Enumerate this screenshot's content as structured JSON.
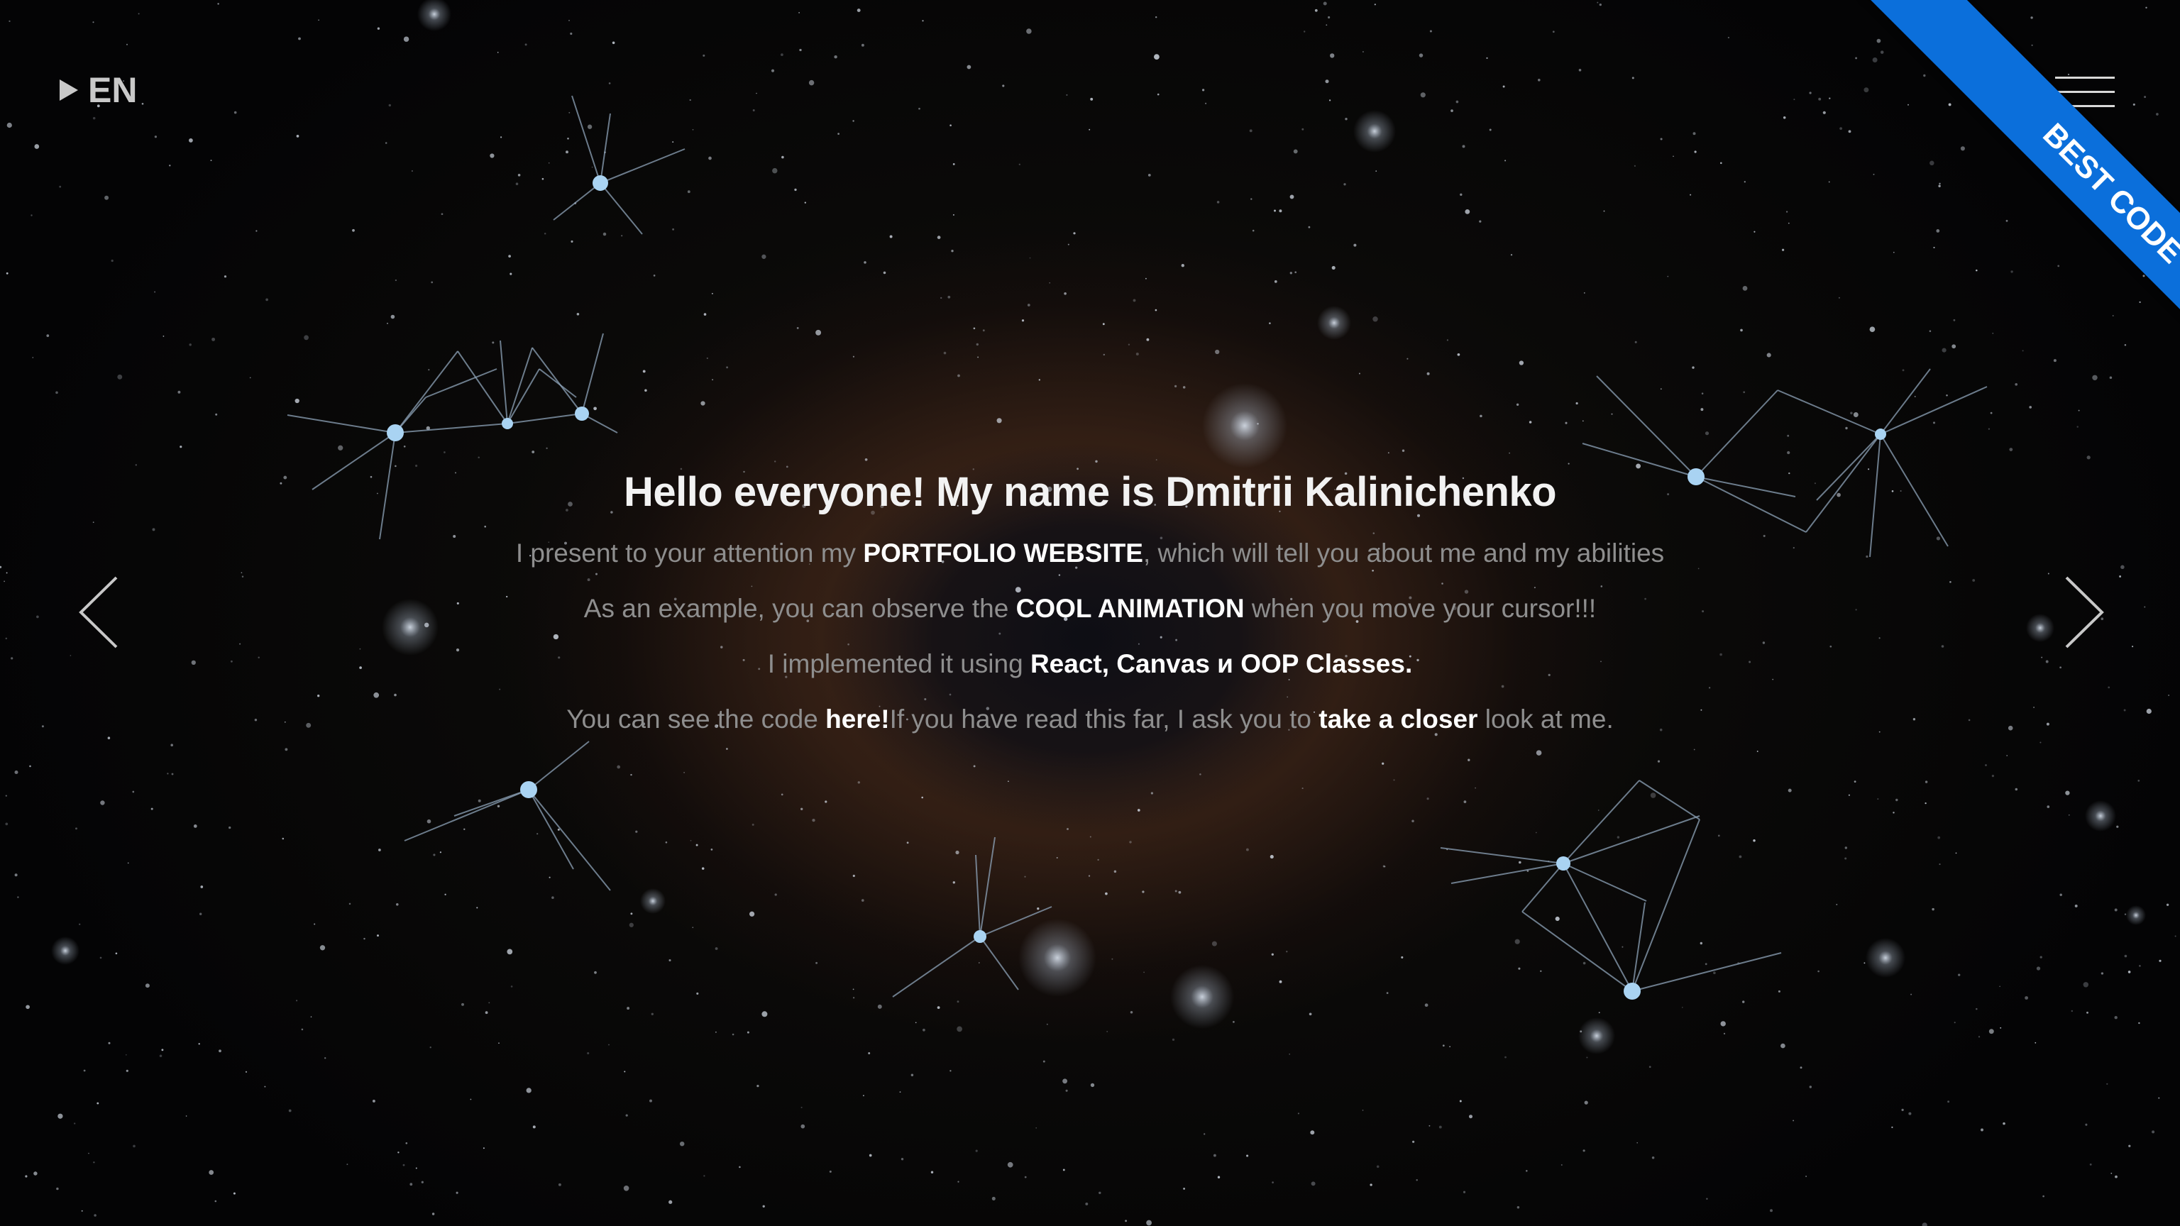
{
  "language": {
    "label": "EN"
  },
  "ribbon": {
    "label": "BEST CODE",
    "color": "#0b6fdb"
  },
  "intro": {
    "title": "Hello everyone! My name is Dmitrii Kalinichenko",
    "line1": {
      "before": "I present to your attention my ",
      "highlight": "PORTFOLIO WEBSITE",
      "after": ", which will tell you about me and my abilities"
    },
    "line2": {
      "before": "As an example, you can observe the ",
      "highlight": "COOL ANIMATION",
      "after": " when you move your cursor!!!"
    },
    "line3": {
      "before": "I implemented it using ",
      "highlight": "React, Canvas и OOP Classes."
    },
    "line4": {
      "before": "You can see the code ",
      "link1": "here!",
      "middle": "If you have read this far, I ask you to ",
      "link2": "take a closer",
      "after": " look at me."
    }
  },
  "icons": {
    "language_toggle": "play-triangle-icon",
    "menu": "hamburger-menu-icon",
    "prev": "chevron-left-icon",
    "next": "chevron-right-icon"
  },
  "colors": {
    "title": "#f2f2f2",
    "text": "#8e8e8e",
    "highlight": "#ffffff",
    "node": "#a9d3f2",
    "line": "#8ea3b8"
  }
}
